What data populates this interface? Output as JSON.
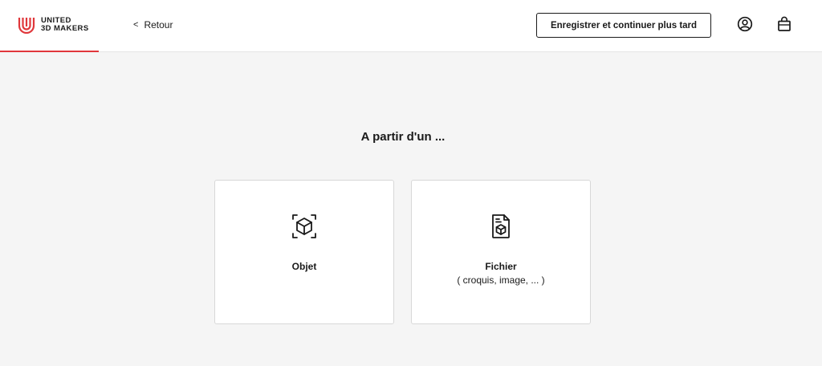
{
  "header": {
    "logo": {
      "line1": "UNITED",
      "line2": "3D MAKERS",
      "icon": "u-logo-icon",
      "color": "#e0373b"
    },
    "back": {
      "chevron": "<",
      "label": "Retour"
    },
    "save_label": "Enregistrer et continuer plus tard",
    "account_icon": "user-circle-icon",
    "cart_icon": "shopping-bag-icon",
    "progress_color": "#e0373b",
    "progress_fraction": 0.12
  },
  "main": {
    "title": "A partir d'un ...",
    "options": [
      {
        "label": "Objet",
        "sublabel": "",
        "icon": "cube-scan-icon"
      },
      {
        "label": "Fichier",
        "sublabel": "( croquis, image, ... )",
        "icon": "file-cube-icon"
      }
    ]
  }
}
